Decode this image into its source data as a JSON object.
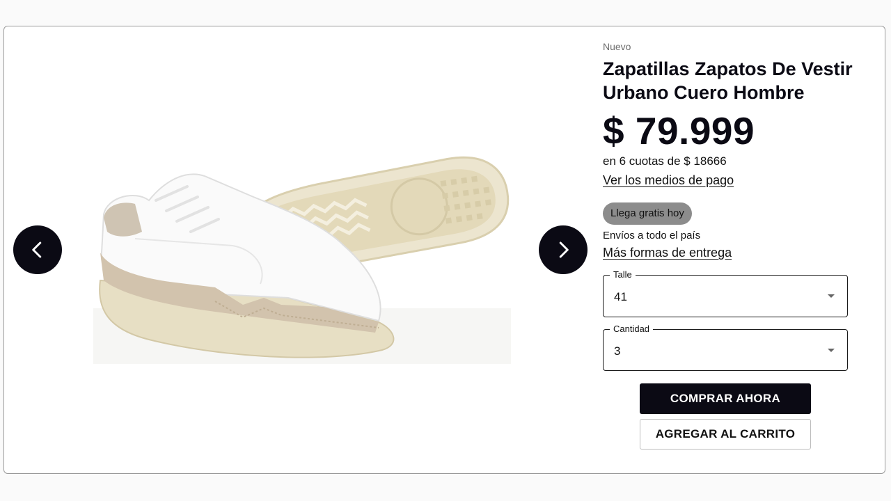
{
  "product": {
    "condition": "Nuevo",
    "title": "Zapatillas Zapatos De Vestir Urbano Cuero Hombre",
    "price": "$ 79.999",
    "installments": "en 6 cuotas de $ 18666",
    "payment_link": "Ver los medios de pago",
    "badge": "Llega gratis hoy",
    "shipping": "Envíos a todo el país",
    "delivery_link": "Más formas de entrega"
  },
  "options": {
    "talle": {
      "label": "Talle",
      "value": "41"
    },
    "cantidad": {
      "label": "Cantidad",
      "value": "3"
    }
  },
  "actions": {
    "buy_label": "COMPRAR AHORA",
    "cart_label": "AGREGAR AL CARRITO"
  },
  "gallery": {
    "prev_icon": "chevron-left-icon",
    "next_icon": "chevron-right-icon"
  },
  "colors": {
    "primary": "#0b0a14",
    "badge_bg": "#8c8c8c",
    "border": "#9a9a9a"
  }
}
